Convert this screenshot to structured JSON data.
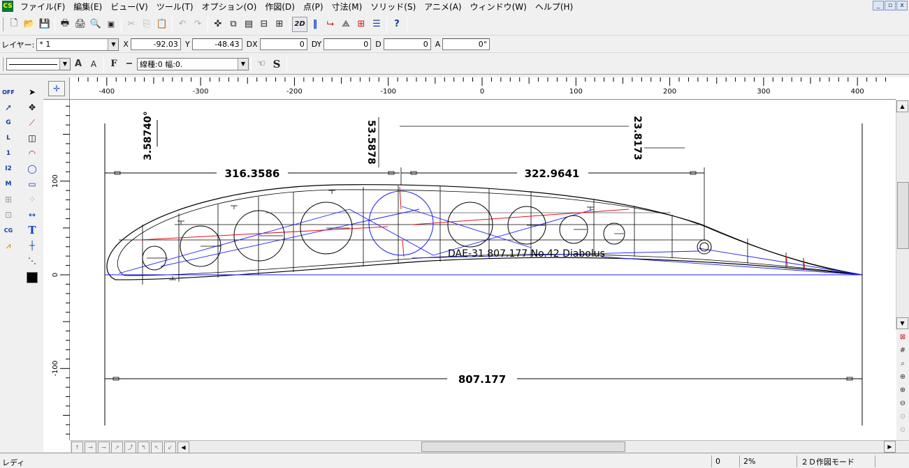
{
  "app_icon": "CS",
  "menu": [
    "ファイル(F)",
    "編集(E)",
    "ビュー(V)",
    "ツール(T)",
    "オプション(O)",
    "作図(D)",
    "点(P)",
    "寸法(M)",
    "ソリッド(S)",
    "アニメ(A)",
    "ウィンドウ(W)",
    "ヘルプ(H)"
  ],
  "window_buttons": [
    "_",
    "▫",
    "x"
  ],
  "coords": {
    "layer_label": "レイヤー:",
    "layer_value": "* 1",
    "x_label": "X",
    "x_value": "-92.03",
    "y_label": "Y",
    "y_value": "-48.43",
    "dx_label": "DX",
    "dx_value": "0",
    "dy_label": "DY",
    "dy_value": "0",
    "d_label": "D",
    "d_value": "0",
    "a_label": "A",
    "a_value": "0°"
  },
  "linetype": {
    "label": "線種:0 幅:0.",
    "text_big": "A",
    "text_small": "A",
    "font_f": "F",
    "dash": "−",
    "s_btn": "S"
  },
  "tb1_labels": {
    "mode2d": "2D",
    "help": "?"
  },
  "left_tools": {
    "off": "OFF",
    "g": "G",
    "l": "L",
    "one": "1",
    "i2": "I2",
    "m": "M",
    "cg": "CG",
    "t": "T"
  },
  "ruler": {
    "h_labels": [
      "-400",
      "-300",
      "-200",
      "-100",
      "0",
      "100",
      "200",
      "300",
      "400"
    ],
    "v_labels": [
      "100",
      "0",
      "-100"
    ]
  },
  "dimensions": {
    "d1": "316.3586",
    "d2": "322.9641",
    "d3": "807.177",
    "d4": "3.58740°",
    "d5": "53.5878",
    "d6": "23.8173"
  },
  "airfoil_label": "DAE-31 807.177 No.42 Diabolus",
  "status": {
    "ready": "レディ",
    "value": "0",
    "zoom": "2%",
    "mode": "２Ｄ作図モード"
  },
  "colors": {
    "blue": "#1a1aff",
    "red": "#e0141e",
    "black": "#000000"
  }
}
